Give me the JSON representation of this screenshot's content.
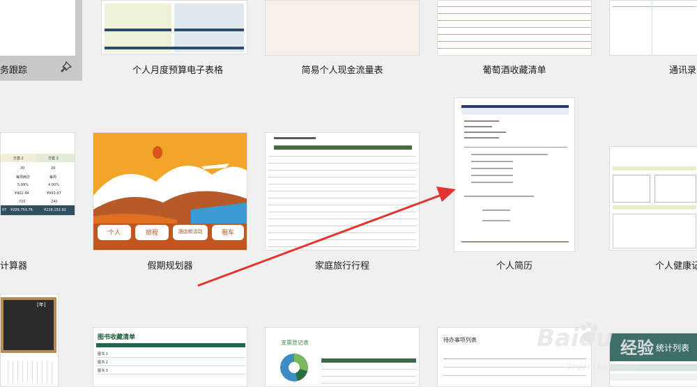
{
  "templates": [
    {
      "label": "务跟踪",
      "pinned": true
    },
    {
      "label": "个人月度预算电子表格"
    },
    {
      "label": "简易个人现金流量表"
    },
    {
      "label": "葡萄酒收藏清单"
    },
    {
      "label": "通讯录"
    },
    {
      "label": "计算器"
    },
    {
      "label": "假期规划器"
    },
    {
      "label": "家庭旅行行程"
    },
    {
      "label": "个人简历"
    },
    {
      "label": "个人健康记"
    }
  ],
  "loan_preview": {
    "headers": [
      "方案 2",
      "方案 3"
    ],
    "rows": [
      [
        "30",
        "20"
      ],
      [
        "每周两次",
        "每周"
      ],
      [
        "5.99%",
        "4.00%"
      ],
      [
        "¥402.44",
        "¥993.97"
      ],
      [
        "720",
        "240"
      ],
      [
        "¥133,753.76",
        "¥48,152.92"
      ]
    ],
    "footer": [
      "07",
      "¥209,753.76",
      "¥218,152.92"
    ]
  },
  "vacation_preview": {
    "buttons": [
      "个人",
      "旅程",
      "酒店和活动",
      "租车"
    ]
  },
  "calendar_preview": {
    "badge": "[年]"
  },
  "book_preview": {
    "title": "图书收藏清单",
    "rows": [
      "图书 1",
      "图书 2",
      "图书 3"
    ]
  },
  "expense_preview": {
    "title": "支票登记表"
  },
  "todo_preview": {
    "title": "待办事项列表"
  },
  "green_preview": {
    "title": "统计列表"
  },
  "watermark": {
    "brand": "Baidu",
    "sub": "经验",
    "url": "jingyan.baidu.com"
  },
  "colors": {
    "accent_red": "#e3342f",
    "selected_bg": "#c9c9c9",
    "green": "#3d6b45",
    "orange": "#e8862a"
  }
}
